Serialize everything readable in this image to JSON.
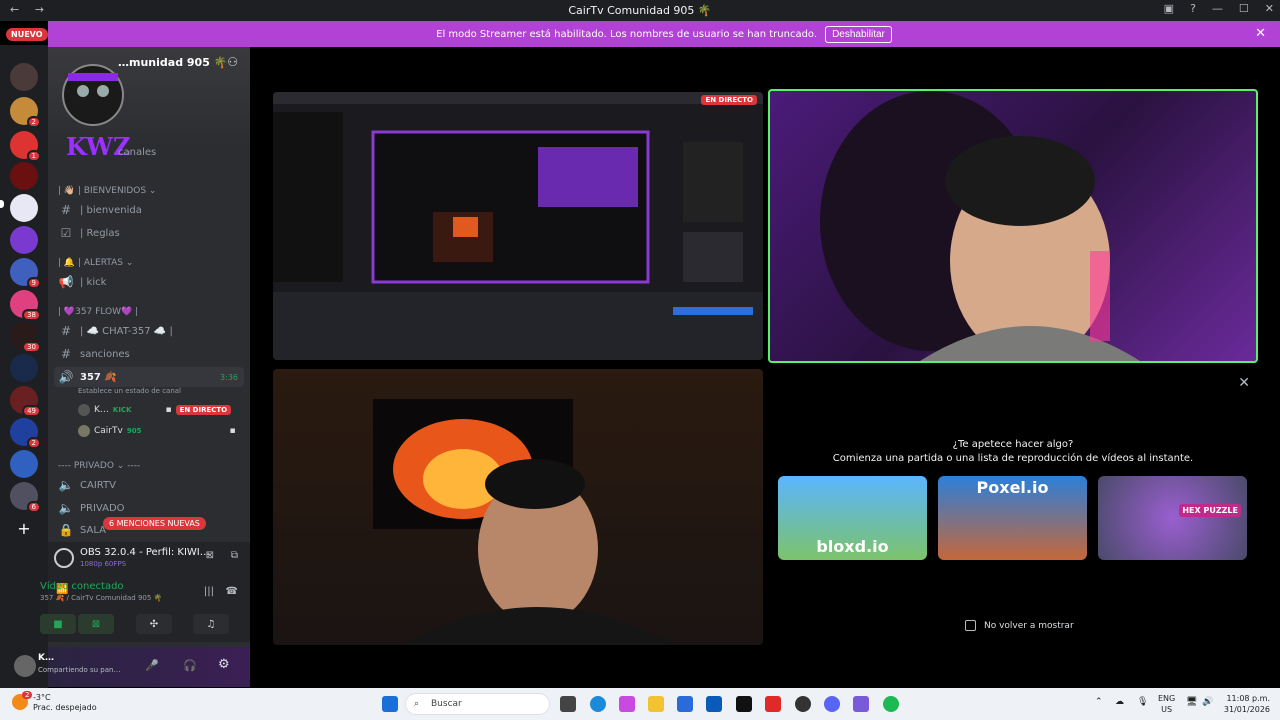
{
  "window": {
    "title": "CairTv Comunidad 905 🌴",
    "back": "←",
    "forward": "→",
    "minimize": "—",
    "maximize": "☐",
    "close": "✕"
  },
  "banner": {
    "text": "El modo Streamer está habilitado. Los nombres de usuario se han truncado.",
    "button": "Deshabilitar",
    "close": "✕"
  },
  "nuevo_badge": "NUEVO",
  "server_rail": {
    "servers": [
      {
        "badge": ""
      },
      {
        "badge": "2"
      },
      {
        "badge": "1"
      },
      {
        "badge": ""
      },
      {
        "badge": ""
      },
      {
        "badge": ""
      },
      {
        "badge": "9"
      },
      {
        "badge": "38"
      },
      {
        "badge": "30"
      },
      {
        "badge": ""
      },
      {
        "badge": "49"
      },
      {
        "badge": "2"
      },
      {
        "badge": ""
      },
      {
        "badge": "6"
      }
    ],
    "add_server": "+"
  },
  "sidebar": {
    "server_name": "…munidad 905 🌴",
    "channels_label": "canales",
    "categories": {
      "bienvenidos": "| 👋🏼 | BIENVENIDOS ⌄",
      "alertas": "| 🔔 | ALERTAS ⌄",
      "flow": "| 💜357 FLOW💜 |",
      "privado": "---- PRIVADO ⌄ ----"
    },
    "channels": {
      "bienvenida": "| bienvenida",
      "reglas": "| Reglas",
      "kick": "| kick",
      "chat": "| ☁️ CHAT-357 ☁️ |",
      "sanciones": "sanciones",
      "voice_357": "357 🍂",
      "voice_timer": "3:36",
      "voice_status": "Establece un estado de canal",
      "cairtv": "CAIRTV",
      "privado": "PRIVADO",
      "sala": "SALA"
    },
    "voice_users": [
      {
        "name": "K…",
        "tag": "KICK",
        "live": "EN DIRECTO"
      },
      {
        "name": "CairTv",
        "tag": "905"
      }
    ],
    "mentions": "6 MENCIONES NUEVAS"
  },
  "stream_panel": {
    "title": "OBS 32.0.4 - Perfil: KIWI KICK ...",
    "quality": "1080p 60FPS",
    "status": "Vídeo conectado",
    "location": "357 🍂 / CairTv Comunidad 905 🌴"
  },
  "user_panel": {
    "name": "K…",
    "status": "Compartiendo su pan…"
  },
  "stage": {
    "live_label": "EN DIRECTO",
    "activity": {
      "question": "¿Te apetece hacer algo?",
      "subtitle": "Comienza una partida o una lista de reproducción de vídeos al instante.",
      "games": [
        {
          "name": "bloxd.io"
        },
        {
          "name": "Poxel.io"
        },
        {
          "name": "HEX PUZZLE"
        }
      ],
      "dont_show": "No volver a mostrar",
      "close": "✕"
    }
  },
  "taskbar": {
    "weather_temp": "-3°C",
    "weather_desc": "Prac. despejado",
    "weather_badge": "2",
    "search": "Buscar",
    "lang": "ENG",
    "region": "US",
    "time": "11:08 p.m.",
    "date": "31/01/2026"
  }
}
